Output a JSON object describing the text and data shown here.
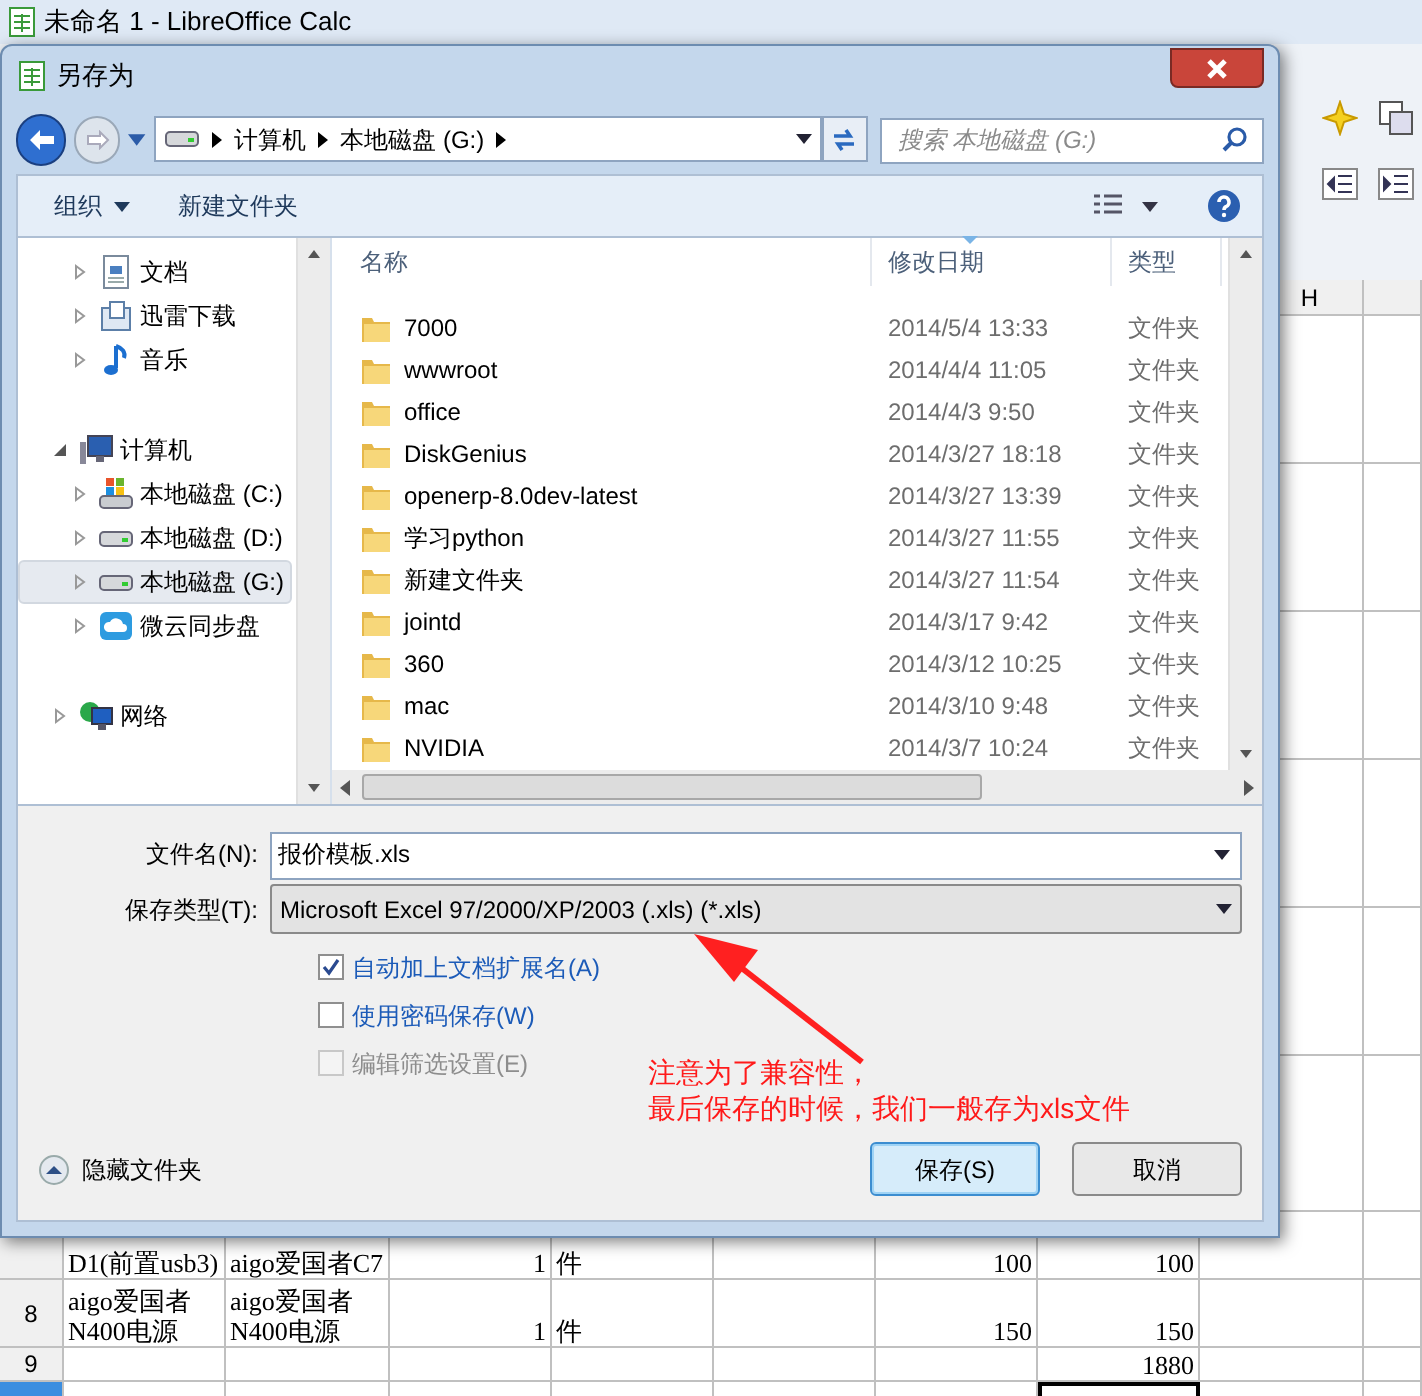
{
  "app_window": {
    "title": "未命名 1 - LibreOffice Calc"
  },
  "sheet": {
    "visible_column_header": "H",
    "rows": [
      {
        "selected": false,
        "cells": {
          "A": "D1(前置usb3)",
          "B": "aigo爱国者C7",
          "C": "1",
          "D": "件",
          "F": "100",
          "G": "100"
        }
      },
      {
        "header": "8",
        "selected": false,
        "cells": {
          "A": "aigo爱国者\nN400电源",
          "B": "aigo爱国者\nN400电源",
          "C": "1",
          "D": "件",
          "F": "150",
          "G": "150"
        }
      },
      {
        "header": "9",
        "selected": false,
        "cells": {
          "G": "1880"
        }
      },
      {
        "selected": true,
        "cells": {}
      }
    ]
  },
  "dialog": {
    "title": "另存为",
    "address": {
      "crumbs": [
        "计算机",
        "本地磁盘 (G:)"
      ]
    },
    "search": {
      "placeholder": "搜索 本地磁盘 (G:)"
    },
    "toolbar": {
      "organize": "组织",
      "new_folder": "新建文件夹"
    },
    "nav_tree": [
      {
        "children": [
          {
            "label": "文档",
            "kind": "document",
            "expanded": false,
            "selected": false
          },
          {
            "label": "迅雷下载",
            "kind": "download",
            "expanded": false,
            "selected": false
          },
          {
            "label": "音乐",
            "kind": "music",
            "expanded": false,
            "selected": false
          }
        ]
      },
      {
        "label": "计算机",
        "kind": "computer",
        "expanded": true,
        "selected": false,
        "children": [
          {
            "label": "本地磁盘 (C:)",
            "kind": "system-drive",
            "expanded": false,
            "selected": false
          },
          {
            "label": "本地磁盘 (D:)",
            "kind": "drive",
            "expanded": false,
            "selected": false
          },
          {
            "label": "本地磁盘 (G:)",
            "kind": "drive",
            "expanded": false,
            "selected": true
          },
          {
            "label": "微云同步盘",
            "kind": "cloud",
            "expanded": false,
            "selected": false
          }
        ]
      },
      {
        "label": "网络",
        "kind": "network",
        "expanded": false,
        "selected": false
      }
    ],
    "file_list": {
      "columns": [
        {
          "label": "名称",
          "sorted": false
        },
        {
          "label": "修改日期",
          "sorted": true
        },
        {
          "label": "类型",
          "sorted": false
        }
      ],
      "rows": [
        {
          "name": "7000",
          "modified": "2014/5/4 13:33",
          "type": "文件夹"
        },
        {
          "name": "wwwroot",
          "modified": "2014/4/4 11:05",
          "type": "文件夹"
        },
        {
          "name": "office",
          "modified": "2014/4/3 9:50",
          "type": "文件夹"
        },
        {
          "name": "DiskGenius",
          "modified": "2014/3/27 18:18",
          "type": "文件夹"
        },
        {
          "name": "openerp-8.0dev-latest",
          "modified": "2014/3/27 13:39",
          "type": "文件夹"
        },
        {
          "name": "学习python",
          "modified": "2014/3/27 11:55",
          "type": "文件夹"
        },
        {
          "name": "新建文件夹",
          "modified": "2014/3/27 11:54",
          "type": "文件夹"
        },
        {
          "name": "jointd",
          "modified": "2014/3/17 9:42",
          "type": "文件夹"
        },
        {
          "name": "360",
          "modified": "2014/3/12 10:25",
          "type": "文件夹"
        },
        {
          "name": "mac",
          "modified": "2014/3/10 9:48",
          "type": "文件夹"
        },
        {
          "name": "NVIDIA",
          "modified": "2014/3/7 10:24",
          "type": "文件夹"
        }
      ]
    },
    "filename": {
      "label": "文件名(N):",
      "value": "报价模板.xls"
    },
    "save_type": {
      "label": "保存类型(T):",
      "value": "Microsoft Excel 97/2000/XP/2003 (.xls) (*.xls)"
    },
    "options": [
      {
        "label": "自动加上文档扩展名(A)",
        "checked": true,
        "disabled": false
      },
      {
        "label": "使用密码保存(W)",
        "checked": false,
        "disabled": false
      },
      {
        "label": "编辑筛选设置(E)",
        "checked": false,
        "disabled": true
      }
    ],
    "annotation": {
      "lines": [
        "注意为了兼容性，",
        "最后保存的时候，我们一般存为xls文件"
      ]
    },
    "hide_folders": "隐藏文件夹",
    "buttons": [
      {
        "label": "保存(S)",
        "default": true
      },
      {
        "label": "取消",
        "default": false
      }
    ]
  }
}
